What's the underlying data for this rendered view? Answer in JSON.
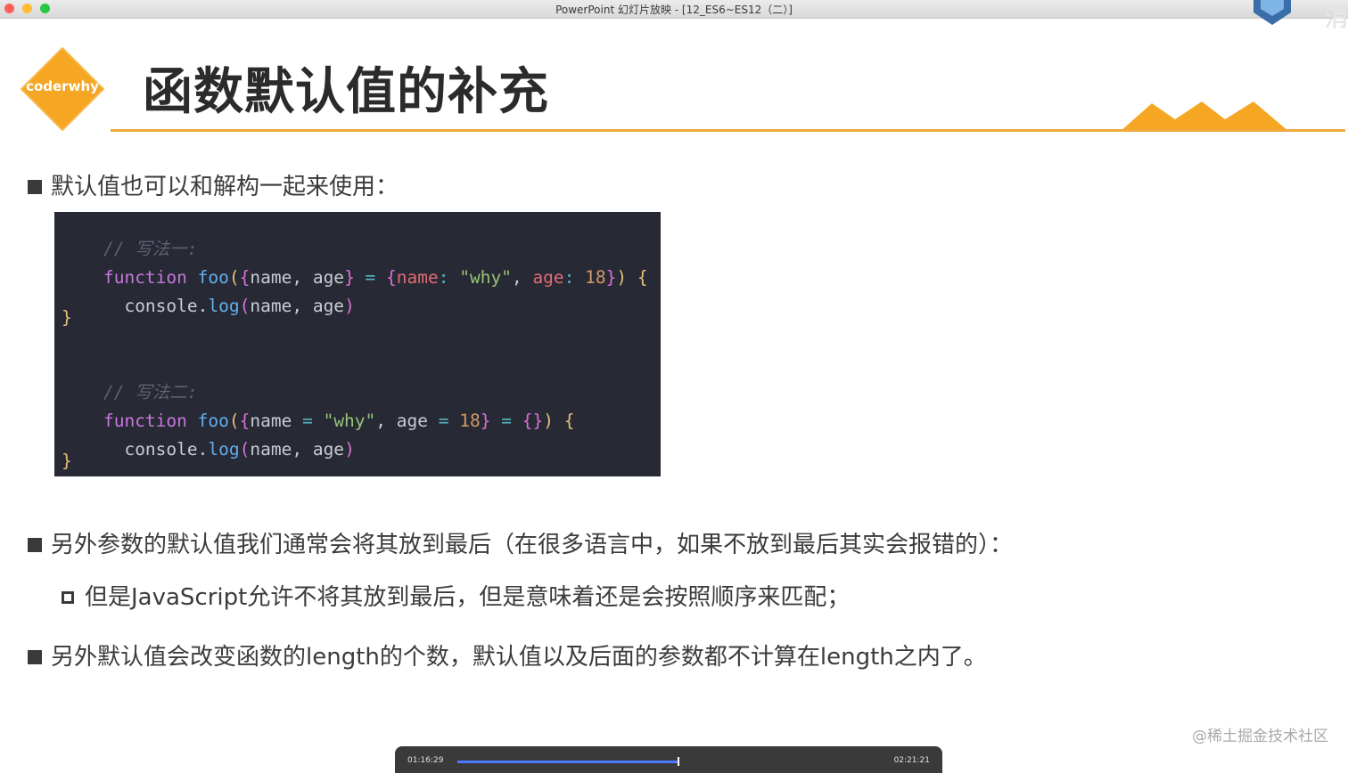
{
  "window": {
    "title": "PowerPoint 幻灯片放映 - [12_ES6~ES12（二）]"
  },
  "corner": {
    "text": "消"
  },
  "slide": {
    "logo_text": "coderwhy",
    "title": "函数默认值的补充",
    "bullets": [
      "默认值也可以和解构一起来使用：",
      "另外参数的默认值我们通常会将其放到最后（在很多语言中，如果不放到最后其实会报错的）：",
      "但是JavaScript允许不将其放到最后，但是意味着还是会按照顺序来匹配；",
      "另外默认值会改变函数的length的个数，默认值以及后面的参数都不计算在length之内了。"
    ],
    "code": {
      "comment1": "// 写法一:",
      "comment2": "// 写法二:",
      "kw": "function",
      "fn": "foo",
      "console": "console",
      "log": "log",
      "name": "name",
      "age": "age",
      "why": "\"why\"",
      "num": "18"
    }
  },
  "watermark": "@稀土掘金技术社区",
  "player": {
    "current_time": "01:16:29",
    "total_time": "02:21:21",
    "progress": 0.54
  },
  "colors": {
    "accent": "#f2a93b",
    "code_bg": "#272934"
  }
}
